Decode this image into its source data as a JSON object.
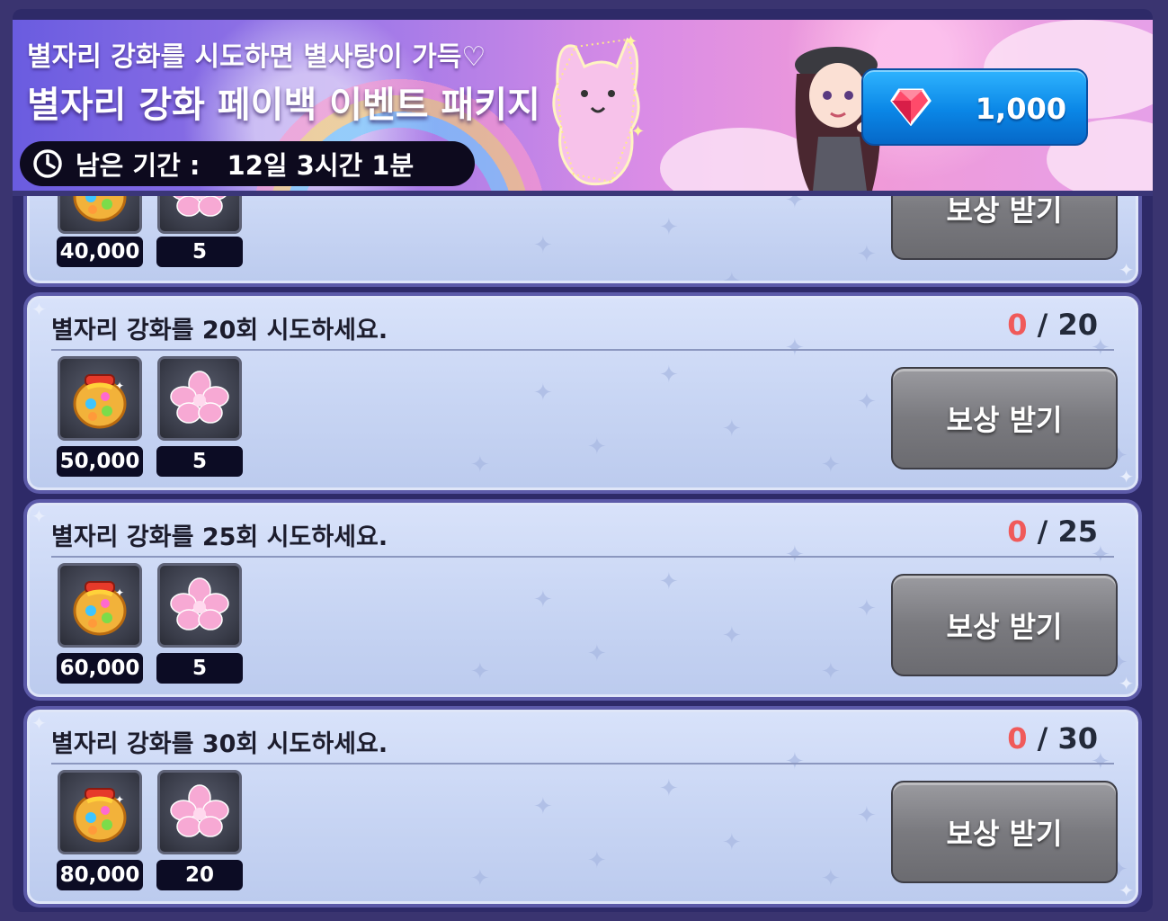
{
  "banner": {
    "subtitle": "별자리 강화를 시도하면 별사탕이 가득♡",
    "title": "별자리 강화 페이백 이벤트 패키지",
    "timer_label": "남은 기간 :",
    "timer_value": "12일 3시간 1분",
    "price": "1,000",
    "price_icon": "ruby-gem-icon"
  },
  "colors": {
    "accent_progress": "#f05a5a",
    "price_button": "#0a86e6",
    "claim_button": "#7a7a7f",
    "card_background": "#c9d6f4",
    "frame": "#2e2a68"
  },
  "missions": [
    {
      "title": "",
      "progress_current": "",
      "progress_total": "",
      "rewards": [
        {
          "icon": "star-candy-jar-icon",
          "qty": "40,000"
        },
        {
          "icon": "pink-flower-icon",
          "qty": "5"
        }
      ],
      "button": "보상 받기"
    },
    {
      "title": "별자리 강화를 20회 시도하세요.",
      "progress_current": "0",
      "progress_total": "20",
      "rewards": [
        {
          "icon": "star-candy-jar-icon",
          "qty": "50,000"
        },
        {
          "icon": "pink-flower-icon",
          "qty": "5"
        }
      ],
      "button": "보상 받기"
    },
    {
      "title": "별자리 강화를 25회 시도하세요.",
      "progress_current": "0",
      "progress_total": "25",
      "rewards": [
        {
          "icon": "star-candy-jar-icon",
          "qty": "60,000"
        },
        {
          "icon": "pink-flower-icon",
          "qty": "5"
        }
      ],
      "button": "보상 받기"
    },
    {
      "title": "별자리 강화를 30회 시도하세요.",
      "progress_current": "0",
      "progress_total": "30",
      "rewards": [
        {
          "icon": "star-candy-jar-icon",
          "qty": "80,000"
        },
        {
          "icon": "pink-flower-icon",
          "qty": "20"
        }
      ],
      "button": "보상 받기"
    }
  ]
}
